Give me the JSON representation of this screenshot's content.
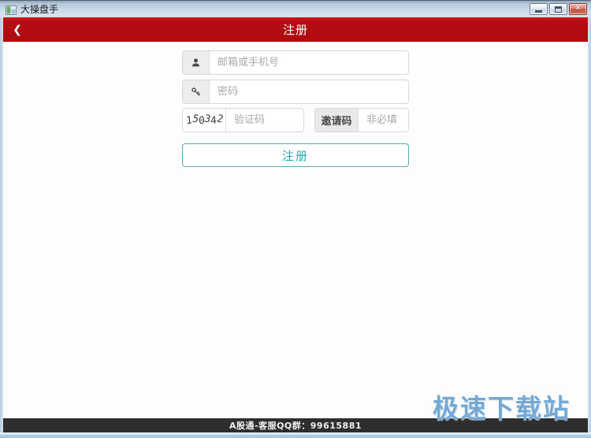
{
  "window": {
    "title": "大操盘手",
    "controls": {
      "close_glyph": "✕"
    }
  },
  "header": {
    "back_glyph": "❮",
    "title": "注册"
  },
  "form": {
    "account": {
      "placeholder": "邮箱或手机号",
      "value": ""
    },
    "password": {
      "placeholder": "密码",
      "value": ""
    },
    "captcha": {
      "code": "150342",
      "placeholder": "验证码",
      "value": ""
    },
    "invite": {
      "label": "邀请码",
      "placeholder": "非必填",
      "value": ""
    },
    "submit_label": "注册"
  },
  "footer": {
    "support_text": "A股通-客服QQ群：99615881"
  },
  "watermark": {
    "text": "极速下载站"
  },
  "colors": {
    "header_red": "#b20d10",
    "accent_teal": "#35a0b2",
    "footer_bg": "#2e2e2e",
    "titlebar_blue": "#ccd9e8"
  }
}
